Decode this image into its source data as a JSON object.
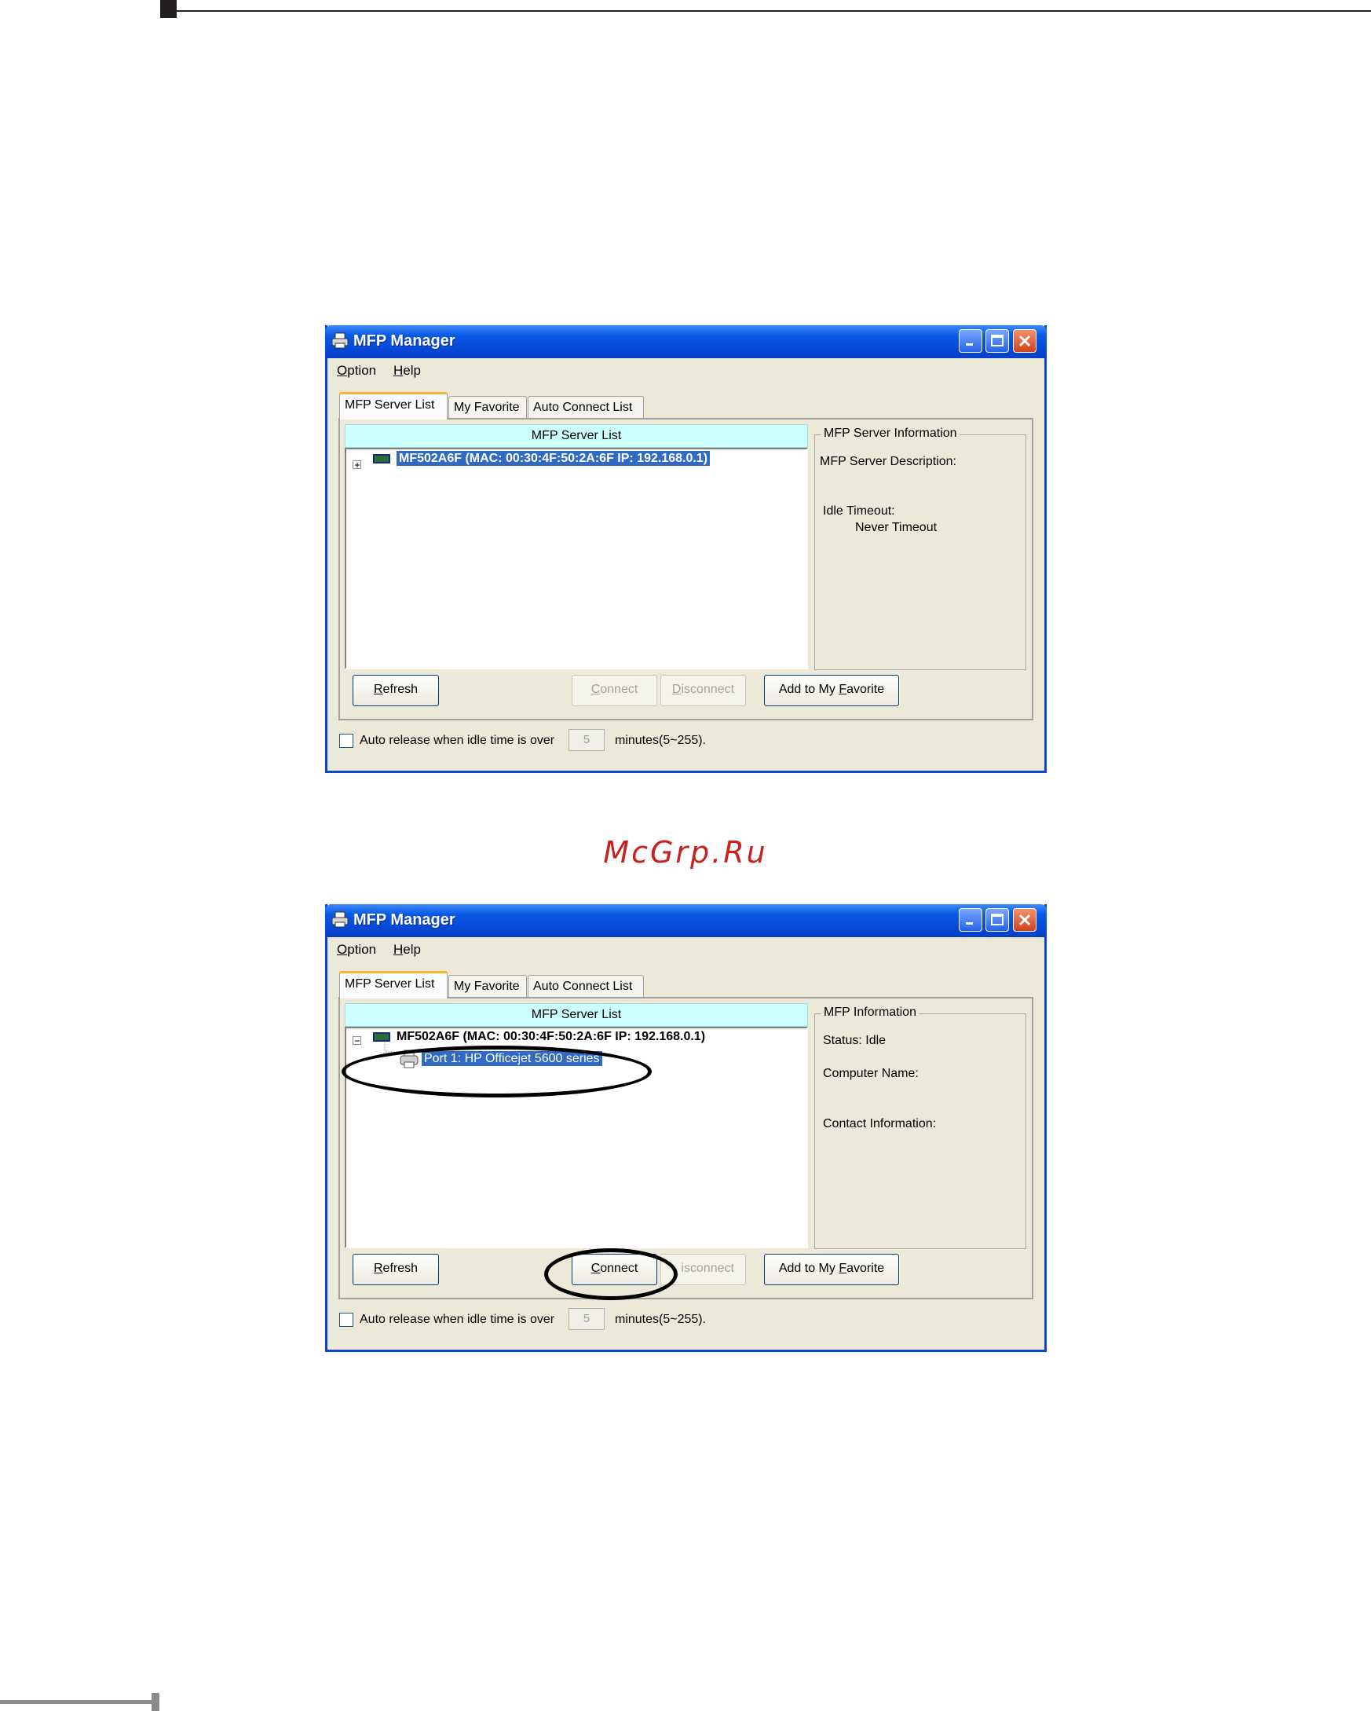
{
  "watermark": "McGrp.Ru",
  "windows": [
    {
      "title": "MFP Manager",
      "menu": [
        {
          "u": "O",
          "rest": "ption"
        },
        {
          "u": "H",
          "rest": "elp"
        }
      ],
      "tabs": [
        "MFP Server List",
        "My Favorite",
        "Auto Connect List"
      ],
      "list_header": "MFP Server List",
      "server_item": "MF502A6F (MAC: 00:30:4F:50:2A:6F   IP: 192.168.0.1)",
      "info_title": "MFP Server Information",
      "info_lines": [
        "MFP Server Description:",
        "Idle Timeout:",
        "Never Timeout"
      ],
      "buttons": {
        "refresh_u": "R",
        "refresh_rest": "efresh",
        "connect_u": "C",
        "connect_rest": "onnect",
        "disconnect_u": "D",
        "disconnect_rest": "isconnect",
        "fav_pre": "Add to My ",
        "fav_u": "F",
        "fav_rest": "avorite"
      },
      "auto_release_label": "Auto release when idle time is over",
      "minutes_value": "5",
      "minutes_label": "minutes(5~255)."
    },
    {
      "title": "MFP Manager",
      "menu": [
        {
          "u": "O",
          "rest": "ption"
        },
        {
          "u": "H",
          "rest": "elp"
        }
      ],
      "tabs": [
        "MFP Server List",
        "My Favorite",
        "Auto Connect List"
      ],
      "list_header": "MFP Server List",
      "server_item": "MF502A6F (MAC: 00:30:4F:50:2A:6F   IP: 192.168.0.1)",
      "port_item": "Port 1: HP Officejet 5600 series",
      "info_title": "MFP Information",
      "info_lines": [
        "Status: Idle",
        "Computer Name:",
        "Contact Information:"
      ],
      "buttons": {
        "refresh_u": "R",
        "refresh_rest": "efresh",
        "connect_u": "C",
        "connect_rest": "onnect",
        "disconnect_visible": "isconnect",
        "fav_pre": "Add to My ",
        "fav_u": "F",
        "fav_rest": "avorite"
      },
      "auto_release_label": "Auto release when idle time is over",
      "minutes_value": "5",
      "minutes_label": "minutes(5~255)."
    }
  ]
}
